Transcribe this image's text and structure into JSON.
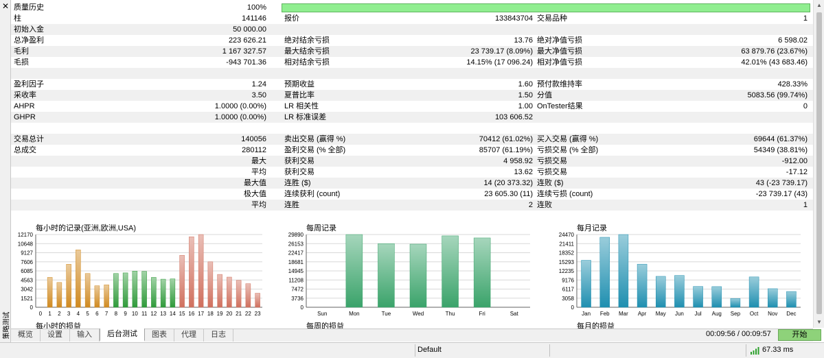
{
  "side": {
    "close_glyph": "✕",
    "panel_title": "策略测试"
  },
  "quality": {
    "label": "质量历史",
    "value": "100%",
    "fraction": 1.0,
    "bar_color": "#90ee90"
  },
  "rows": [
    {
      "type": "data",
      "alt": false,
      "cells": [
        "柱",
        "141146",
        "报价",
        "133843704",
        "交易品种",
        "1"
      ]
    },
    {
      "type": "data",
      "alt": true,
      "cells": [
        "初始入金",
        "50 000.00",
        "",
        "",
        "",
        ""
      ]
    },
    {
      "type": "data",
      "alt": false,
      "cells": [
        "总净盈利",
        "223 626.21",
        "绝对结余亏损",
        "13.76",
        "绝对净值亏损",
        "6 598.02"
      ]
    },
    {
      "type": "data",
      "alt": true,
      "cells": [
        "毛利",
        "1 167 327.57",
        "最大结余亏损",
        "23 739.17 (8.09%)",
        "最大净值亏损",
        "63 879.76 (23.67%)"
      ]
    },
    {
      "type": "data",
      "alt": false,
      "cells": [
        "毛损",
        "-943 701.36",
        "相对结余亏损",
        "14.15% (17 096.24)",
        "相对净值亏损",
        "42.01% (43 683.46)"
      ]
    },
    {
      "type": "blank",
      "alt": true,
      "cells": [
        "",
        "",
        "",
        "",
        "",
        ""
      ]
    },
    {
      "type": "data",
      "alt": false,
      "cells": [
        "盈利因子",
        "1.24",
        "预期收益",
        "1.60",
        "预付款维持率",
        "428.33%"
      ]
    },
    {
      "type": "data",
      "alt": true,
      "cells": [
        "采收率",
        "3.50",
        "夏普比率",
        "1.50",
        "分值",
        "5083.56 (99.74%)"
      ]
    },
    {
      "type": "data",
      "alt": false,
      "cells": [
        "AHPR",
        "1.0000 (0.00%)",
        "LR 相关性",
        "1.00",
        "OnTester结果",
        "0"
      ]
    },
    {
      "type": "data",
      "alt": true,
      "cells": [
        "GHPR",
        "1.0000 (0.00%)",
        "LR 标准误差",
        "103 606.52",
        "",
        ""
      ]
    },
    {
      "type": "blank",
      "alt": false,
      "cells": [
        "",
        "",
        "",
        "",
        "",
        ""
      ]
    },
    {
      "type": "data",
      "alt": true,
      "cells": [
        "交易总计",
        "140056",
        "卖出交易 (赢得 %)",
        "70412 (61.02%)",
        "买入交易 (赢得 %)",
        "69644 (61.37%)"
      ]
    },
    {
      "type": "data",
      "alt": false,
      "cells": [
        "总成交",
        "280112",
        "盈利交易 (% 全部)",
        "85707 (61.19%)",
        "亏损交易 (% 全部)",
        "54349 (38.81%)"
      ]
    },
    {
      "type": "data",
      "alt": true,
      "cells": [
        "",
        "最大",
        "获利交易",
        "4 958.92",
        "亏损交易",
        "-912.00"
      ]
    },
    {
      "type": "data",
      "alt": false,
      "cells": [
        "",
        "平均",
        "获利交易",
        "13.62",
        "亏损交易",
        "-17.12"
      ]
    },
    {
      "type": "data",
      "alt": true,
      "cells": [
        "",
        "最大值",
        "连胜 ($)",
        "14 (20 373.32)",
        "连败 ($)",
        "43 (-23 739.17)"
      ]
    },
    {
      "type": "data",
      "alt": false,
      "cells": [
        "",
        "极大值",
        "连续获利 (count)",
        "23 605.30 (11)",
        "连续亏损 (count)",
        "-23 739.17 (43)"
      ]
    },
    {
      "type": "data",
      "alt": true,
      "cells": [
        "",
        "平均",
        "连胜",
        "2",
        "连败",
        "1"
      ]
    },
    {
      "type": "blank",
      "alt": false,
      "cells": [
        "",
        "",
        "",
        "",
        "",
        ""
      ]
    }
  ],
  "chart_data": [
    {
      "type": "bar",
      "title": "每小时的记录(亚洲,欧洲,USA)",
      "subtitle": "每小时的损益",
      "categories": [
        "0",
        "1",
        "2",
        "3",
        "4",
        "5",
        "6",
        "7",
        "8",
        "9",
        "10",
        "11",
        "12",
        "13",
        "14",
        "15",
        "16",
        "17",
        "18",
        "19",
        "20",
        "21",
        "22",
        "23"
      ],
      "values": [
        0,
        5000,
        4150,
        7200,
        9600,
        5650,
        3600,
        3750,
        5650,
        5750,
        6050,
        6000,
        5000,
        4700,
        4750,
        8700,
        11800,
        12170,
        7600,
        5500,
        5050,
        4500,
        3950,
        2350
      ],
      "yticks": [
        "12170",
        "10648",
        "9127",
        "7606",
        "6085",
        "4563",
        "3042",
        "1521",
        "0"
      ],
      "ylim": [
        0,
        12170
      ],
      "series_colors_by_group": {
        "asia": "#d08a20",
        "europe": "#2f9a3a",
        "usa": "#d0705e"
      },
      "groups": [
        "asia",
        "asia",
        "asia",
        "asia",
        "asia",
        "asia",
        "asia",
        "asia",
        "europe",
        "europe",
        "europe",
        "europe",
        "europe",
        "europe",
        "europe",
        "usa",
        "usa",
        "usa",
        "usa",
        "usa",
        "usa",
        "usa",
        "usa",
        "usa"
      ]
    },
    {
      "type": "bar",
      "title": "每周记录",
      "subtitle": "每周的损益",
      "categories": [
        "Sun",
        "Mon",
        "Tue",
        "Wed",
        "Thu",
        "Fri",
        "Sat"
      ],
      "values": [
        0,
        29890,
        26150,
        25950,
        29350,
        28500,
        0
      ],
      "yticks": [
        "29890",
        "26153",
        "22417",
        "18681",
        "14945",
        "11208",
        "7472",
        "3736",
        "0"
      ],
      "ylim": [
        0,
        29890
      ],
      "color": "#3aa36a"
    },
    {
      "type": "bar",
      "title": "每月记录",
      "subtitle": "每月的损益",
      "categories": [
        "Jan",
        "Feb",
        "Mar",
        "Apr",
        "May",
        "Jun",
        "Jul",
        "Aug",
        "Sep",
        "Oct",
        "Nov",
        "Dec"
      ],
      "values": [
        15800,
        23550,
        24470,
        14500,
        10400,
        10700,
        7000,
        6950,
        2950,
        10200,
        6250,
        5300
      ],
      "yticks": [
        "24470",
        "21411",
        "18352",
        "15293",
        "12235",
        "9176",
        "6117",
        "3058",
        "0"
      ],
      "ylim": [
        0,
        24470
      ],
      "color": "#1f8fb0"
    }
  ],
  "tabs": [
    {
      "label": "概览",
      "active": false
    },
    {
      "label": "设置",
      "active": false
    },
    {
      "label": "输入",
      "active": false
    },
    {
      "label": "后台测试",
      "active": true
    },
    {
      "label": "图表",
      "active": false
    },
    {
      "label": "代理",
      "active": false
    },
    {
      "label": "日志",
      "active": false
    }
  ],
  "timer": "00:09:56 / 00:09:57",
  "start_label": "开始",
  "status": {
    "profile": "Default",
    "ping": "67.33 ms",
    "signal_icon": "signal-bars-icon"
  }
}
